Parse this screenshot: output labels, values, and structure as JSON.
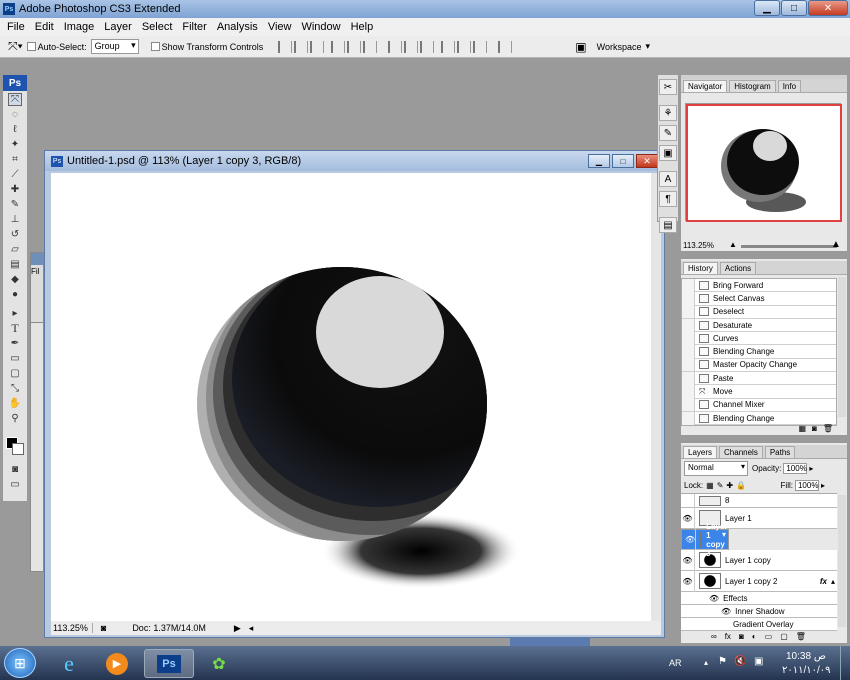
{
  "app": {
    "title": "Adobe Photoshop CS3 Extended",
    "logo": "Ps"
  },
  "menu": [
    "File",
    "Edit",
    "Image",
    "Layer",
    "Select",
    "Filter",
    "Analysis",
    "View",
    "Window",
    "Help"
  ],
  "options": {
    "auto_select_label": "Auto-Select:",
    "auto_select_value": "Group",
    "transform_label": "Show Transform Controls",
    "workspace_label": "Workspace"
  },
  "document": {
    "title": "Untitled-1.psd @ 113% (Layer 1 copy 3, RGB/8)",
    "zoom": "113.25%",
    "doc_info": "Doc: 1.37M/14.0M"
  },
  "background_doc": {
    "menu_peek": "Fil"
  },
  "navigator": {
    "tabs": [
      "Navigator",
      "Histogram",
      "Info"
    ],
    "zoom": "113.25%"
  },
  "history": {
    "tabs": [
      "History",
      "Actions"
    ],
    "items": [
      "Bring Forward",
      "Select Canvas",
      "Deselect",
      "Desaturate",
      "Curves",
      "Blending Change",
      "Master Opacity Change",
      "Paste",
      "Move",
      "Channel Mixer",
      "Blending Change"
    ]
  },
  "layers": {
    "tabs": [
      "Layers",
      "Channels",
      "Paths"
    ],
    "blend_mode": "Normal",
    "opacity_label": "Opacity:",
    "opacity": "100%",
    "lock_label": "Lock:",
    "fill_label": "Fill:",
    "fill": "100%",
    "rows": [
      {
        "name": "8",
        "selected": false,
        "fx": false
      },
      {
        "name": "Layer 1",
        "selected": false,
        "fx": false
      },
      {
        "name": "Layer 1 copy 3",
        "selected": true,
        "fx": false
      },
      {
        "name": "Layer 1 copy",
        "selected": false,
        "fx": false
      },
      {
        "name": "Layer 1 copy 2",
        "selected": false,
        "fx": true
      }
    ],
    "effects_label": "Effects",
    "effect_items": [
      "Inner Shadow",
      "Gradient Overlay"
    ]
  },
  "taskbar": {
    "lang": "AR",
    "time": "10:38",
    "ampm": "ص",
    "date": "٢٠١١/١٠/٠٩",
    "ps_label": "Ps"
  },
  "colors": {
    "selected_layer": "#3b84e8",
    "titlebar": "#a9c4e6",
    "accent_red": "#e04040"
  }
}
